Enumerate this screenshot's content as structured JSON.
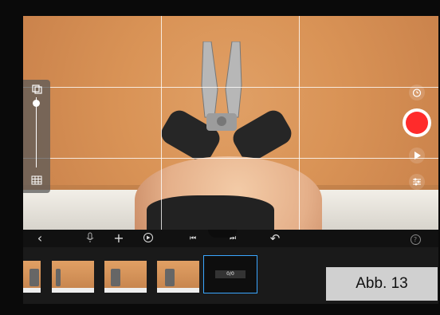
{
  "caption": {
    "label": "Abb. 13"
  },
  "toolbar": {
    "back_icon": "chevron-left-icon",
    "mic_icon": "microphone-icon",
    "add_icon": "plus-icon",
    "speed_icon": "speed-icon",
    "prev_frame_icon": "skip-back-icon",
    "next_frame_icon": "skip-forward-icon",
    "undo_icon": "undo-icon",
    "help_icon": "help-icon",
    "glyphs": {
      "back": "‹",
      "add": "+",
      "undo": "↶",
      "help": "?",
      "prev": "⏮",
      "next": "⏭"
    }
  },
  "camera": {
    "timer_icon": "timer-icon",
    "record_icon": "record-icon",
    "play_icon": "play-icon",
    "settings_icon": "sliders-icon",
    "zoom_top_icon": "layers-icon",
    "zoom_bottom_icon": "grid-icon",
    "record_color": "#ff2b2b"
  },
  "timeline": {
    "frame_counter": "0/0",
    "thumbnails": 4
  },
  "colors": {
    "accent": "#3aa6ff",
    "background": "#000000"
  }
}
